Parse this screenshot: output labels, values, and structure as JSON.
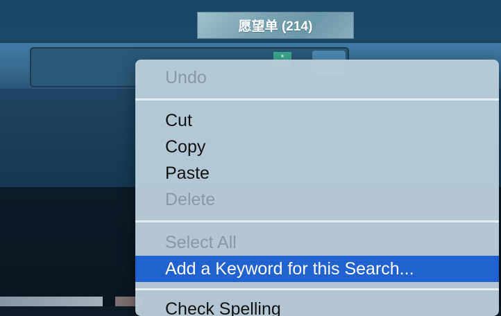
{
  "header": {
    "wishlist_label": "愿望单 (214)"
  },
  "search": {
    "badge": "*"
  },
  "context_menu": {
    "items": [
      {
        "label": "Undo",
        "enabled": false
      },
      {
        "label": "Cut",
        "enabled": true
      },
      {
        "label": "Copy",
        "enabled": true
      },
      {
        "label": "Paste",
        "enabled": true
      },
      {
        "label": "Delete",
        "enabled": false
      },
      {
        "label": "Select All",
        "enabled": false
      },
      {
        "label": "Add a Keyword for this Search...",
        "enabled": true,
        "highlighted": true
      },
      {
        "label": "Check Spelling",
        "enabled": true
      }
    ]
  },
  "colors": {
    "highlight": "#1f62d0",
    "menu_bg": "#bacdda",
    "page_bg": "#1a4664"
  }
}
